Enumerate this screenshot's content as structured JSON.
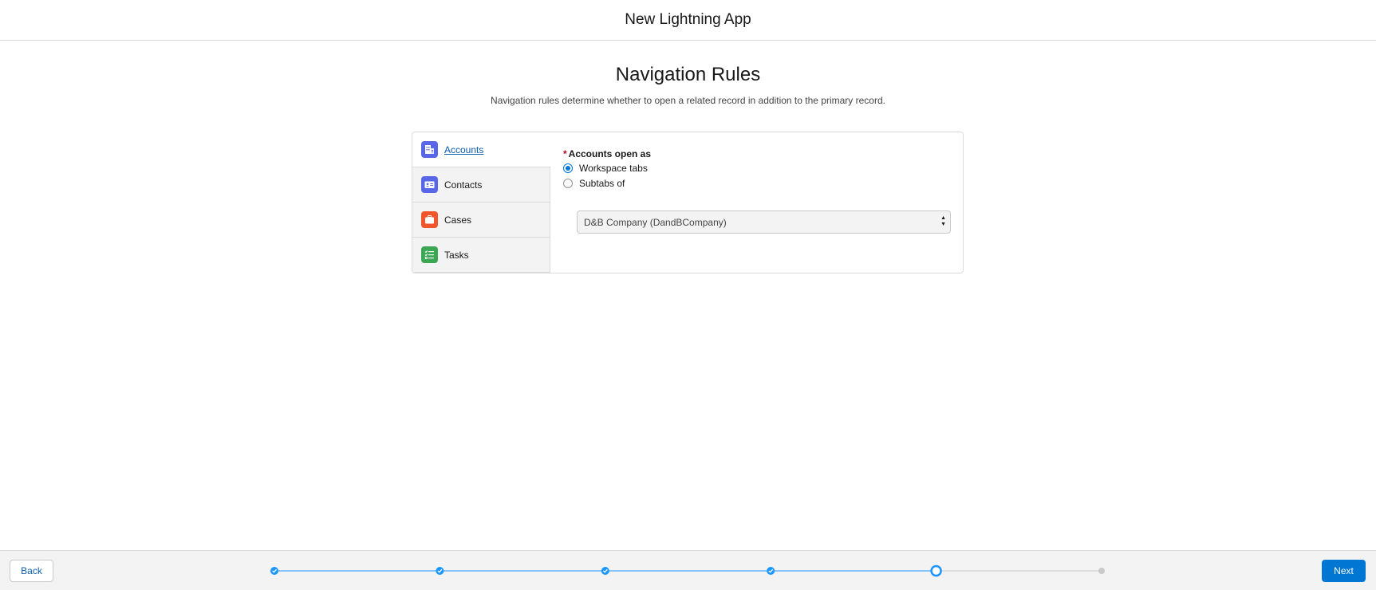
{
  "header": {
    "title": "New Lightning App"
  },
  "section": {
    "title": "Navigation Rules",
    "description": "Navigation rules determine whether to open a related record in addition to the primary record."
  },
  "nav": {
    "items": [
      {
        "label": "Accounts",
        "icon": "account-icon",
        "color": "#5867e8",
        "active": true
      },
      {
        "label": "Contacts",
        "icon": "contact-icon",
        "color": "#5867e8",
        "active": false
      },
      {
        "label": "Cases",
        "icon": "case-icon",
        "color": "#f2542b",
        "active": false
      },
      {
        "label": "Tasks",
        "icon": "task-icon",
        "color": "#3ba755",
        "active": false
      }
    ]
  },
  "form": {
    "required_marker": "*",
    "label": "Accounts open as",
    "options": [
      {
        "label": "Workspace tabs",
        "checked": true
      },
      {
        "label": "Subtabs of",
        "checked": false
      }
    ],
    "select_value": "D&B Company (DandBCompany)"
  },
  "footer": {
    "back_label": "Back",
    "next_label": "Next",
    "progress": {
      "total_steps": 6,
      "completed_steps": 4,
      "current_step": 5
    }
  },
  "colors": {
    "accent": "#0176d3",
    "progress_line": "#1b96ff",
    "inactive": "#c9c9c9"
  }
}
